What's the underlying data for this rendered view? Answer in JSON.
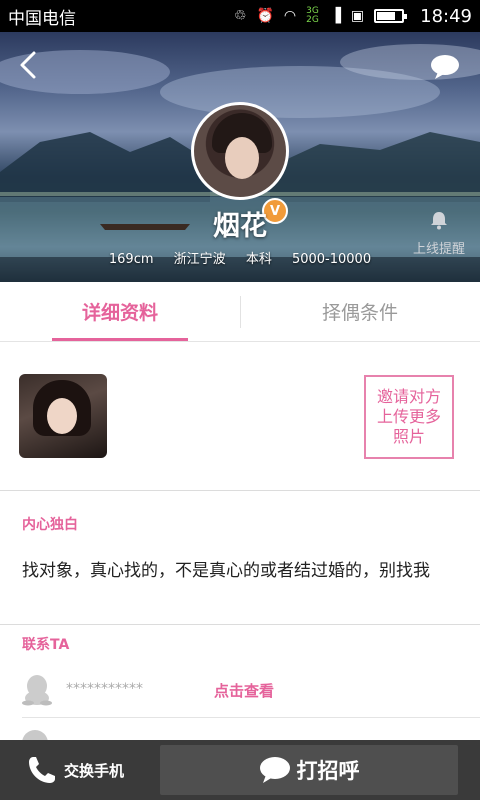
{
  "status_bar": {
    "carrier": "中国电信",
    "network": "3G 2G",
    "time": "18:49",
    "battery_level": 0.7
  },
  "profile": {
    "nickname": "烟花",
    "vip_badge": "V",
    "height": "169cm",
    "location": "浙江宁波",
    "education": "本科",
    "income": "5000-10000",
    "online_remind_label": "上线提醒"
  },
  "tabs": [
    {
      "label": "详细资料",
      "active": true
    },
    {
      "label": "择偶条件",
      "active": false
    }
  ],
  "photos": {
    "invite_label": "邀请对方上传更多照片"
  },
  "monologue": {
    "title": "内心独白",
    "text": "找对象，真心找的，不是真心的或者结过婚的，别找我"
  },
  "contact": {
    "title": "联系TA",
    "qq_masked": "***********",
    "view_link": "点击查看"
  },
  "bottom_bar": {
    "exchange_phone_label": "交换手机",
    "greet_label": "打招呼"
  },
  "colors": {
    "accent": "#e5639b",
    "bottom_bar": "#3a3a3a",
    "vip": "#f19b3a"
  },
  "icons": [
    "back-icon",
    "chat-bubble-icon",
    "bell-icon",
    "qq-icon",
    "phone-icon",
    "speech-bubble-icon"
  ]
}
